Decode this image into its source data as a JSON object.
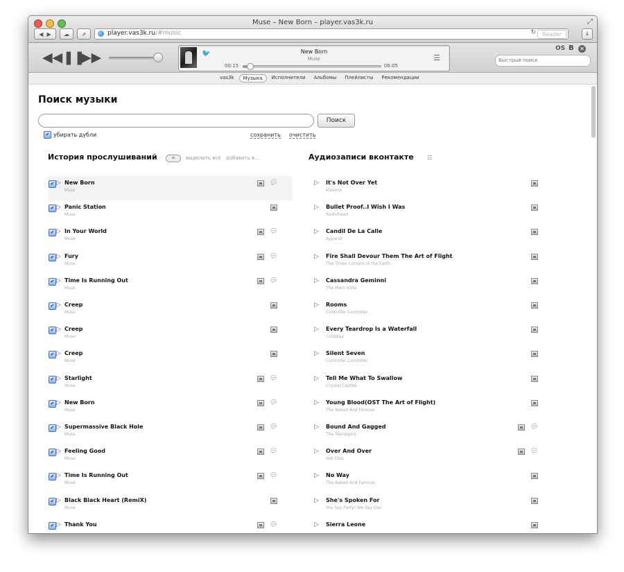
{
  "window": {
    "title": "Muse – New Born – player.vas3k.ru",
    "url_host": "player.vas3k.ru",
    "url_path": "/#music",
    "reader_label": "Reader",
    "traffic_lights": [
      "#ee5b52",
      "#f5be3e",
      "#5fc24e"
    ]
  },
  "player": {
    "rewind_icon": "rewind-icon",
    "pause_icon": "pause-icon",
    "forward_icon": "fast-forward-icon",
    "volume": 0.92,
    "now_playing": {
      "title": "New Born",
      "artist": "Muse",
      "elapsed": "00:15",
      "total": "06:05",
      "progress": 0.05
    },
    "os_label": "OS",
    "b_label": "B",
    "quick_search_placeholder": "Быстрый поиск"
  },
  "menu": {
    "items": [
      "vas3k",
      "Музыка",
      "Исполнители",
      "Альбомы",
      "Плейлисты",
      "Рекомендации"
    ],
    "active": "Музыка"
  },
  "search": {
    "title": "Поиск музыки",
    "input_value": "",
    "button": "Поиск",
    "dedupe_label": "убирать дубли",
    "save_label": "сохранить",
    "clear_label": "очистить"
  },
  "history": {
    "title": "История прослушиваний",
    "select_all": "выделить всё",
    "add_to": "добавить в...",
    "tracks": [
      {
        "title": "New Born",
        "artist": "Muse",
        "comment": true,
        "highlight": true
      },
      {
        "title": "Panic Station",
        "artist": "Muse",
        "comment": false
      },
      {
        "title": "In Your World",
        "artist": "Muse",
        "comment": true
      },
      {
        "title": "Fury",
        "artist": "Muse",
        "comment": true
      },
      {
        "title": "Time Is Running Out",
        "artist": "Muse",
        "comment": true
      },
      {
        "title": "Creep",
        "artist": "Muse",
        "comment": false
      },
      {
        "title": "Creep",
        "artist": "Muse",
        "comment": false
      },
      {
        "title": "Creep",
        "artist": "Muse",
        "comment": false
      },
      {
        "title": "Starlight",
        "artist": "Muse",
        "comment": true
      },
      {
        "title": "New Born",
        "artist": "Muse",
        "comment": true
      },
      {
        "title": "Supermassive Black Hole",
        "artist": "Muse",
        "comment": true
      },
      {
        "title": "Feeling Good",
        "artist": "Muse",
        "comment": true
      },
      {
        "title": "Time Is Running Out",
        "artist": "Muse",
        "comment": true
      },
      {
        "title": "Black Black Heart (RemiX)",
        "artist": "Muse",
        "comment": false
      },
      {
        "title": "Thank You",
        "artist": "",
        "comment": true
      }
    ]
  },
  "vk": {
    "title": "Аудиозаписи вконтакте",
    "tracks": [
      {
        "title": "It's Not Over Yet",
        "artist": "Klaxons",
        "comment": false
      },
      {
        "title": "Bullet Proof..I Wish I Was",
        "artist": "Radiohead",
        "comment": false
      },
      {
        "title": "Candil De La Calle",
        "artist": "Apparat",
        "comment": false
      },
      {
        "title": "Fire Shall Devour Them The Art of Flight",
        "artist": "The Three Corners of the Earth",
        "comment": false
      },
      {
        "title": "Cassandra Geminni",
        "artist": "The Mars Volta",
        "comment": false
      },
      {
        "title": "Rooms",
        "artist": "Controller.Controller",
        "comment": false
      },
      {
        "title": "Every Teardrop Is a Waterfall",
        "artist": "Coldplay",
        "comment": false
      },
      {
        "title": "Silent Seven",
        "artist": "Controller.Controller",
        "comment": false
      },
      {
        "title": "Tell Me What To Swallow",
        "artist": "Crystal Castles",
        "comment": false
      },
      {
        "title": "Young Blood(OST The Art of Flight)",
        "artist": "The Naked And Famous",
        "comment": false
      },
      {
        "title": "Bound And Gagged",
        "artist": "The Teenagers",
        "comment": true
      },
      {
        "title": "Over And Over",
        "artist": "Hot Chip",
        "comment": true
      },
      {
        "title": "No Way",
        "artist": "The Naked And Famous",
        "comment": false
      },
      {
        "title": "She's Spoken For",
        "artist": "You Say Party! We Say Die!",
        "comment": false
      },
      {
        "title": "Sierra Leone",
        "artist": "",
        "comment": false
      }
    ]
  }
}
